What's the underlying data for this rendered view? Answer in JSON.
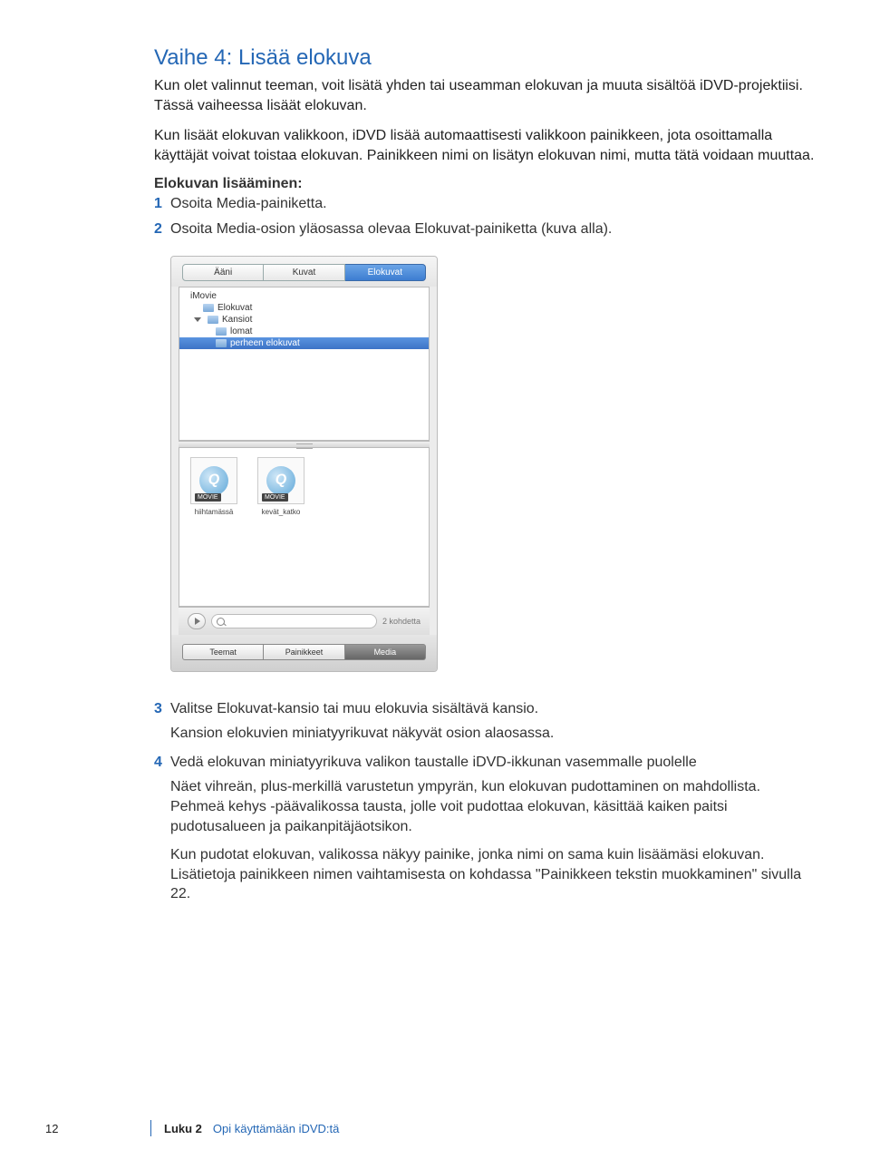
{
  "heading": "Vaihe 4: Lisää elokuva",
  "intro1": "Kun olet valinnut teeman, voit lisätä yhden tai useamman elokuvan ja muuta sisältöä iDVD-projektiisi. Tässä vaiheessa lisäät elokuvan.",
  "intro2": "Kun lisäät elokuvan valikkoon, iDVD lisää automaattisesti valikkoon painikkeen, jota osoittamalla käyttäjät voivat toistaa elokuvan. Painikkeen nimi on lisätyn elokuvan nimi, mutta tätä voidaan muuttaa.",
  "subhead": "Elokuvan lisääminen:",
  "steps": {
    "s1": "Osoita Media-painiketta.",
    "s2": "Osoita Media-osion yläosassa olevaa Elokuvat-painiketta (kuva alla).",
    "s3": "Valitse Elokuvat-kansio tai muu elokuvia sisältävä kansio.",
    "s3b": "Kansion elokuvien miniatyyrikuvat näkyvät osion alaosassa.",
    "s4": "Vedä elokuvan miniatyyrikuva valikon taustalle iDVD-ikkunan vasemmalle puolelle",
    "s4b": "Näet vihreän, plus-merkillä varustetun ympyrän, kun elokuvan pudottaminen on mahdollista. Pehmeä kehys -päävalikossa tausta, jolle voit pudottaa elokuvan, käsittää kaiken paitsi pudotusalueen ja paikanpitäjäotsikon.",
    "s4c": "Kun pudotat elokuvan, valikossa näkyy painike, jonka nimi on sama kuin lisäämäsi elokuvan. Lisätietoja painikkeen nimen vaihtamisesta on kohdassa \"Painikkeen tekstin muokkaminen\" sivulla 22."
  },
  "panel": {
    "tabs": {
      "audio": "Ääni",
      "photos": "Kuvat",
      "movies": "Elokuvat"
    },
    "tree": {
      "imovie": "iMovie",
      "elokuvat": "Elokuvat",
      "kansiot": "Kansiot",
      "lomat": "lomat",
      "perheen": "perheen elokuvat"
    },
    "thumbs": {
      "t1": "hiihtamässä",
      "t2": "kevät_katko",
      "strip": "MOVIE"
    },
    "count": "2 kohdetta",
    "bottom": {
      "teemat": "Teemat",
      "painikkeet": "Painikkeet",
      "media": "Media"
    }
  },
  "footer": {
    "page": "12",
    "chapter": "Luku 2",
    "title": "Opi käyttämään iDVD:tä"
  }
}
